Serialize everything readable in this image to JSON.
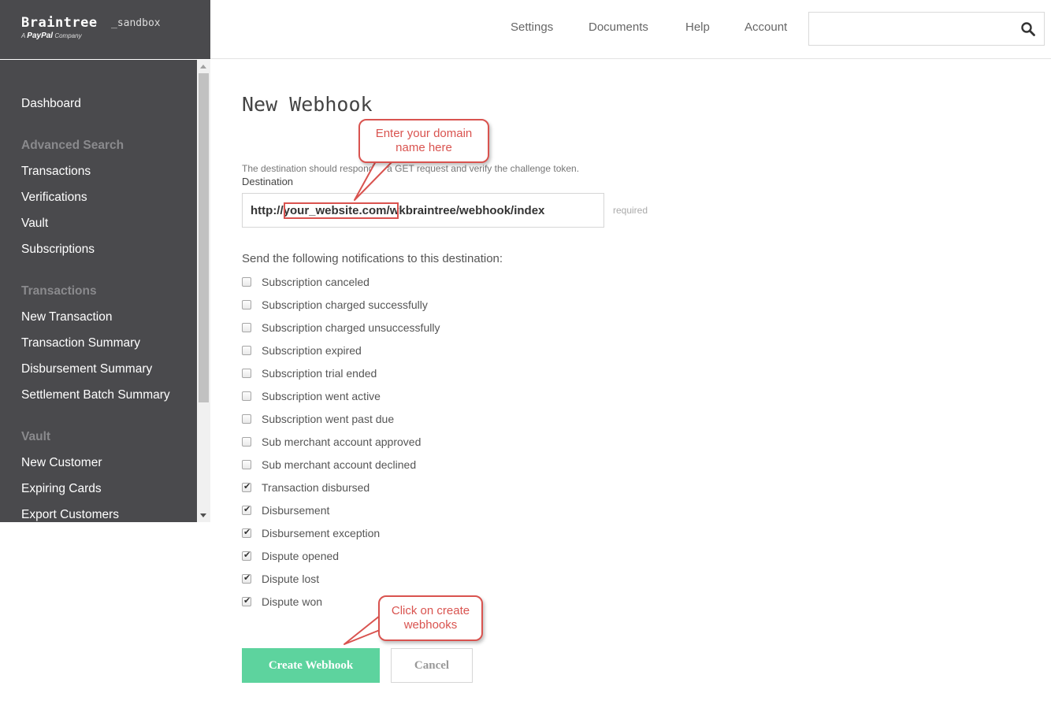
{
  "brand": {
    "name": "Braintree",
    "suffix": "_sandbox",
    "tagline_prefix": "A",
    "tagline_brand": "PayPal",
    "tagline_suffix": "Company"
  },
  "topnav": {
    "links": [
      "Settings",
      "Documents",
      "Help",
      "Account"
    ],
    "search_value": ""
  },
  "sidebar": {
    "items": [
      {
        "type": "item",
        "label": "Dashboard"
      },
      {
        "type": "heading",
        "label": "Advanced Search"
      },
      {
        "type": "item",
        "label": "Transactions"
      },
      {
        "type": "item",
        "label": "Verifications"
      },
      {
        "type": "item",
        "label": "Vault"
      },
      {
        "type": "item",
        "label": "Subscriptions"
      },
      {
        "type": "heading",
        "label": "Transactions"
      },
      {
        "type": "item",
        "label": "New Transaction"
      },
      {
        "type": "item",
        "label": "Transaction Summary"
      },
      {
        "type": "item",
        "label": "Disbursement Summary"
      },
      {
        "type": "item",
        "label": "Settlement Batch Summary"
      },
      {
        "type": "heading",
        "label": "Vault"
      },
      {
        "type": "item",
        "label": "New Customer"
      },
      {
        "type": "item",
        "label": "Expiring Cards"
      },
      {
        "type": "item",
        "label": "Export Customers"
      }
    ]
  },
  "main": {
    "title": "New Webhook",
    "help_text": "The destination should respond to a GET request and verify the challenge token.",
    "destination_label": "Destination",
    "destination_value": "http://your_website.com/wkbraintree/webhook/index",
    "required_label": "required",
    "notifications_heading": "Send the following notifications to this destination:",
    "notifications": [
      {
        "label": "Subscription canceled",
        "checked": false
      },
      {
        "label": "Subscription charged successfully",
        "checked": false
      },
      {
        "label": "Subscription charged unsuccessfully",
        "checked": false
      },
      {
        "label": "Subscription expired",
        "checked": false
      },
      {
        "label": "Subscription trial ended",
        "checked": false
      },
      {
        "label": "Subscription went active",
        "checked": false
      },
      {
        "label": "Subscription went past due",
        "checked": false
      },
      {
        "label": "Sub merchant account approved",
        "checked": false
      },
      {
        "label": "Sub merchant account declined",
        "checked": false
      },
      {
        "label": "Transaction disbursed",
        "checked": true
      },
      {
        "label": "Disbursement",
        "checked": true
      },
      {
        "label": "Disbursement exception",
        "checked": true
      },
      {
        "label": "Dispute opened",
        "checked": true
      },
      {
        "label": "Dispute lost",
        "checked": true
      },
      {
        "label": "Dispute won",
        "checked": true
      }
    ],
    "create_button": "Create Webhook",
    "cancel_button": "Cancel"
  },
  "annotations": {
    "callout_domain": "Enter your domain name here",
    "callout_create": "Click on create webhooks"
  },
  "colors": {
    "sidebar_bg": "#4a4a4d",
    "create_button": "#5dd39e",
    "annotation": "#d9534f"
  }
}
